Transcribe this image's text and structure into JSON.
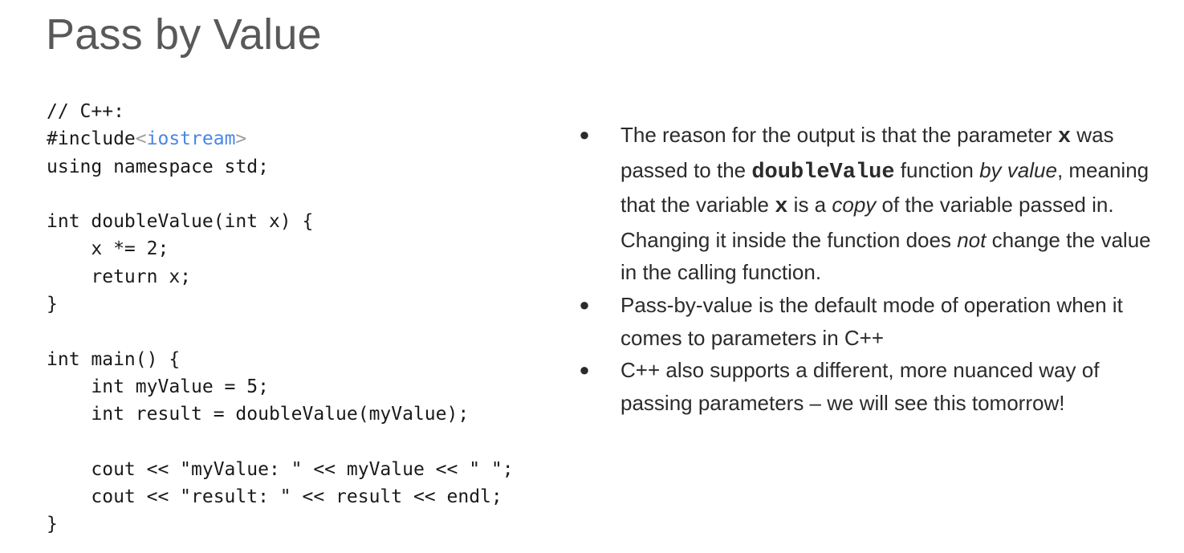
{
  "slide": {
    "title": "Pass by Value"
  },
  "code": {
    "line1": "// C++:",
    "line2_prefix": "#include",
    "line2_lt": "<",
    "line2_target": "iostream",
    "line2_gt": ">",
    "line3": "using namespace std;",
    "line5": "int doubleValue(int x) {",
    "line6": "    x *= 2;",
    "line7": "    return x;",
    "line8": "}",
    "line10": "int main() {",
    "line11": "    int myValue = 5;",
    "line12": "    int result = doubleValue(myValue);",
    "line14": "    cout << \"myValue: \" << myValue << \" \";",
    "line15": "    cout << \"result: \" << result << endl;",
    "line16": "}"
  },
  "bullets": {
    "marker": "●",
    "b1": {
      "t1": "The reason for the output is that the parameter ",
      "code1": "x",
      "t2": " was passed to the ",
      "code2": "doubleValue",
      "t3": " function ",
      "em1": "by value",
      "t4": ", meaning that the variable ",
      "code3": "x",
      "t5": " is a ",
      "em2": "copy",
      "t6": " of the variable passed in. Changing it inside the function does ",
      "em3": "not",
      "t7": " change the value in the calling function."
    },
    "b2": {
      "text": "Pass-by-value is the default mode of operation when it comes to parameters in C++"
    },
    "b3": {
      "text": "C++ also supports a different, more nuanced way of passing parameters – we will see this tomorrow!"
    }
  },
  "colors": {
    "title": "#595959",
    "code_text": "#1a1a1a",
    "include_target": "#4a86e8",
    "angle_brackets": "#9e9e9e",
    "body_text": "#2b2b2b"
  }
}
